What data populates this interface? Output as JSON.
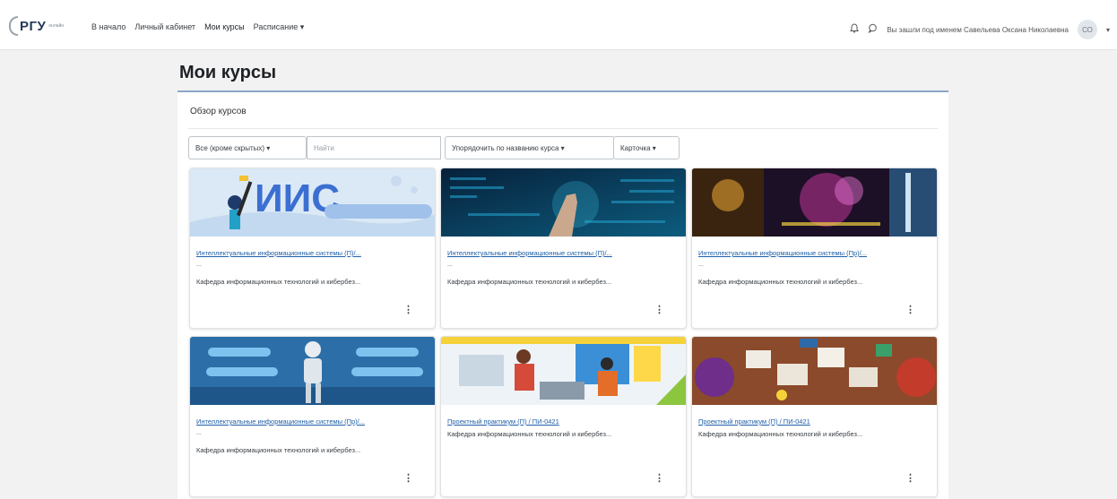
{
  "header": {
    "logo_text": "РГУ",
    "logo_sub": "онлайн",
    "nav": [
      "В начало",
      "Личный кабинет",
      "Мои курсы",
      "Расписание ▾"
    ],
    "bell_icon": "bell-icon",
    "chat_icon": "chat-icon",
    "user_text": "Вы зашли под именем Савельева Оксана Николаевна",
    "avatar_initials": "СО"
  },
  "page": {
    "title": "Мои курсы",
    "overview_label": "Обзор курсов"
  },
  "controls": {
    "filter": "Все (кроме скрытых) ▾",
    "search_placeholder": "Найти",
    "sort": "Упорядочить по названию курса ▾",
    "view": "Карточка ▾"
  },
  "courses": [
    {
      "title": "Интеллектуальные информационные системы (П)/...",
      "dots": "...",
      "category": "Кафедра информационных технологий и кибербез...",
      "image": "iis-banner"
    },
    {
      "title": "Интеллектуальные информационные системы (П)/...",
      "dots": "...",
      "category": "Кафедра информационных технологий и кибербез...",
      "image": "data-tech"
    },
    {
      "title": "Интеллектуальные информационные системы (Пр)/...",
      "dots": "...",
      "category": "Кафедра информационных технологий и кибербез...",
      "image": "city-lights"
    },
    {
      "title": "Интеллектуальные информационные системы (Пр)/...",
      "dots": "...",
      "category": "Кафедра информационных технологий и кибербез...",
      "image": "robot"
    },
    {
      "title": "Проектный практикум (П) / ПИ-0421",
      "category": "Кафедра информационных технологий и кибербез...",
      "image": "teamwork"
    },
    {
      "title": "Проектный практикум (П) / ПИ-0421",
      "category": "Кафедра информационных технологий и кибербез...",
      "image": "desk-topdown"
    }
  ],
  "card_menu_glyph": "⋮"
}
